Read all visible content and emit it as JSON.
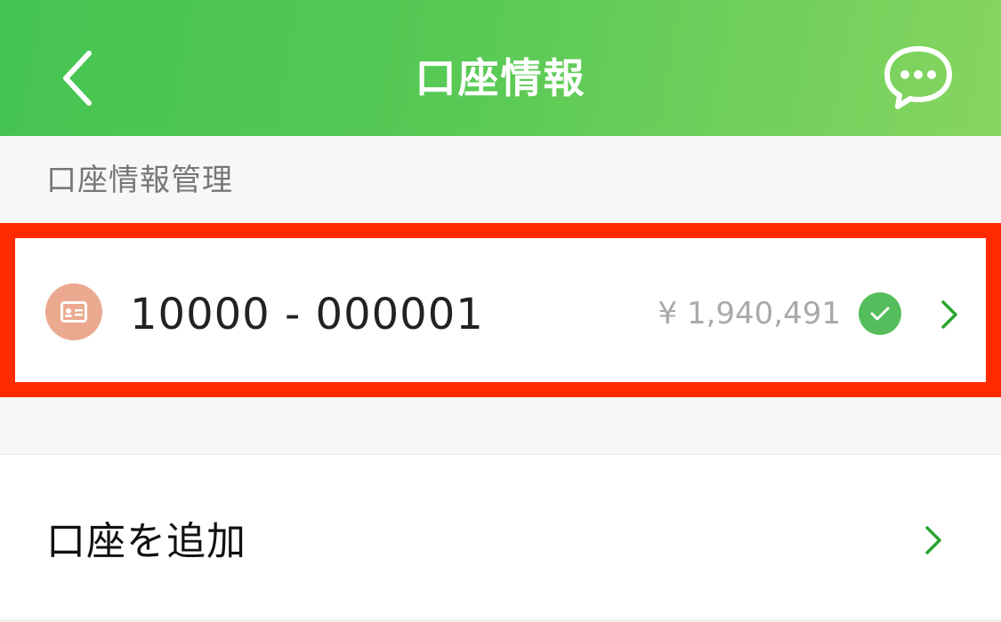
{
  "header": {
    "title": "口座情報",
    "back_icon": "chevron-left-icon",
    "chat_icon": "chat-bubble-icon",
    "gradient_colors": [
      "#45c451",
      "#86d560"
    ]
  },
  "section": {
    "label": "口座情報管理"
  },
  "account": {
    "number": "10000 - 000001",
    "balance": "¥ 1,940,491",
    "icon": "card-icon",
    "icon_bg": "#eba98f",
    "status_icon": "check-circle-icon",
    "status_color": "#55be5c",
    "highlight_color": "#ff2a00"
  },
  "add_account": {
    "label": "口座を追加",
    "chevron_icon": "chevron-right-icon"
  },
  "colors": {
    "accent": "#2aa52f",
    "page_background": "#f7f7f7"
  }
}
